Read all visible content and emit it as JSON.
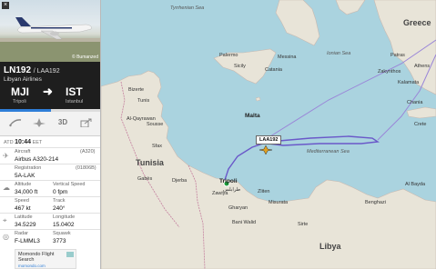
{
  "photo": {
    "copyright": "© Bumanzed"
  },
  "flight": {
    "number": "LN192",
    "callsign": "/ LAA192",
    "airline": "Libyan Airlines",
    "from_code": "MJI",
    "from_city": "Tripoli",
    "to_code": "IST",
    "to_city": "Istanbul",
    "progress": 0.5
  },
  "actions": {
    "view_3d": "3D"
  },
  "ata": {
    "label": "ATD",
    "time": "10:44",
    "tz": "EET"
  },
  "aircraft": {
    "label": "Aircraft",
    "code": "(A320)",
    "value": "Airbus A320-214"
  },
  "registration": {
    "label": "Registration",
    "code": "(01806B)",
    "value": "5A-LAK"
  },
  "altitude": {
    "label": "Altitude",
    "value": "34,000 ft"
  },
  "vspeed": {
    "label": "Vertical Speed",
    "value": "0 fpm"
  },
  "speed": {
    "label": "Speed",
    "value": "467 kt"
  },
  "track": {
    "label": "Track",
    "value": "240°"
  },
  "latitude": {
    "label": "Latitude",
    "value": "34.5229"
  },
  "longitude": {
    "label": "Longitude",
    "value": "15.0402"
  },
  "radar": {
    "label": "Radar",
    "value": "F-LMML3"
  },
  "squawk": {
    "label": "Squawk",
    "value": "3773"
  },
  "ad": {
    "line1": "Momondo Flight",
    "line2": "Search",
    "line3": "momondo.com"
  },
  "map": {
    "flag": "LAA192",
    "labels": {
      "tyrrhenian": "Tyrrhenian Sea",
      "greece": "Greece",
      "ionian": "Ionian Sea",
      "palermo": "Palermo",
      "messina": "Messina",
      "catania": "Catania",
      "malta": "Malta",
      "tunisia": "Tunisia",
      "tripoli": "Tripoli",
      "tripoli_ar": "طرابلس",
      "med": "Mediterranean Sea",
      "libya": "Libya",
      "zawiya": "Zawiya",
      "bizerte": "Bizerte",
      "tunis": "Tunis",
      "sousse": "Sousse",
      "sfax": "Sfax",
      "gabes": "Gabès",
      "kairouan": "Al-Qayrawan",
      "zliten": "Zliten",
      "misurata": "Misurata",
      "bani_walid": "Bani Walid",
      "sirte": "Sirte",
      "benghazi": "Benghazi",
      "bayda": "Al Bayda",
      "djerba": "Djerba",
      "gharyan": "Gharyan",
      "patras": "Patras",
      "zakynthos": "Zakynthos",
      "athens": "Athens",
      "kalamata": "Kalamata",
      "chania": "Chania",
      "crete": "Crete",
      "sicily": "Sicily"
    }
  }
}
